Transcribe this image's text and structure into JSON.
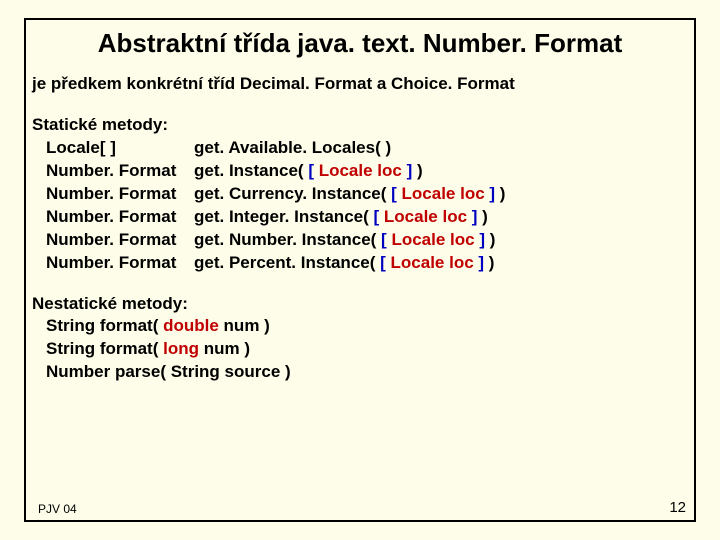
{
  "title": "Abstraktní třída  java. text. Number. Format",
  "intro": "je předkem konkrétní tříd Decimal. Format a Choice. Format",
  "static_label": "Statické metody:",
  "static_methods": [
    {
      "ret": "Locale[ ]",
      "pre": "get. Available. Locales( )",
      "opt": "",
      "post": ""
    },
    {
      "ret": "Number. Format",
      "pre": "get. Instance( ",
      "opt": "[ Locale loc ]",
      "post": " )"
    },
    {
      "ret": "Number. Format",
      "pre": "get. Currency. Instance( ",
      "opt": "[ Locale loc ]",
      "post": " )"
    },
    {
      "ret": "Number. Format",
      "pre": "get. Integer. Instance( ",
      "opt": "[ Locale loc ]",
      "post": " )"
    },
    {
      "ret": "Number. Format",
      "pre": "get. Number. Instance( ",
      "opt": "[ Locale loc ]",
      "post": " )"
    },
    {
      "ret": "Number. Format",
      "pre": "get. Percent. Instance( ",
      "opt": "[ Locale loc ]",
      "post": " )"
    }
  ],
  "nonstatic_label": "Nestatické metody:",
  "nonstatic_methods": [
    {
      "pre": "String  format( ",
      "kw": "double",
      "post": " num )"
    },
    {
      "pre": "String  format( ",
      "kw": "long",
      "post": "    num )"
    },
    {
      "pre": "Number  parse( String source )",
      "kw": "",
      "post": ""
    }
  ],
  "footer": "PJV 04",
  "pagenum": "12",
  "lb": "[",
  "rb": "]"
}
